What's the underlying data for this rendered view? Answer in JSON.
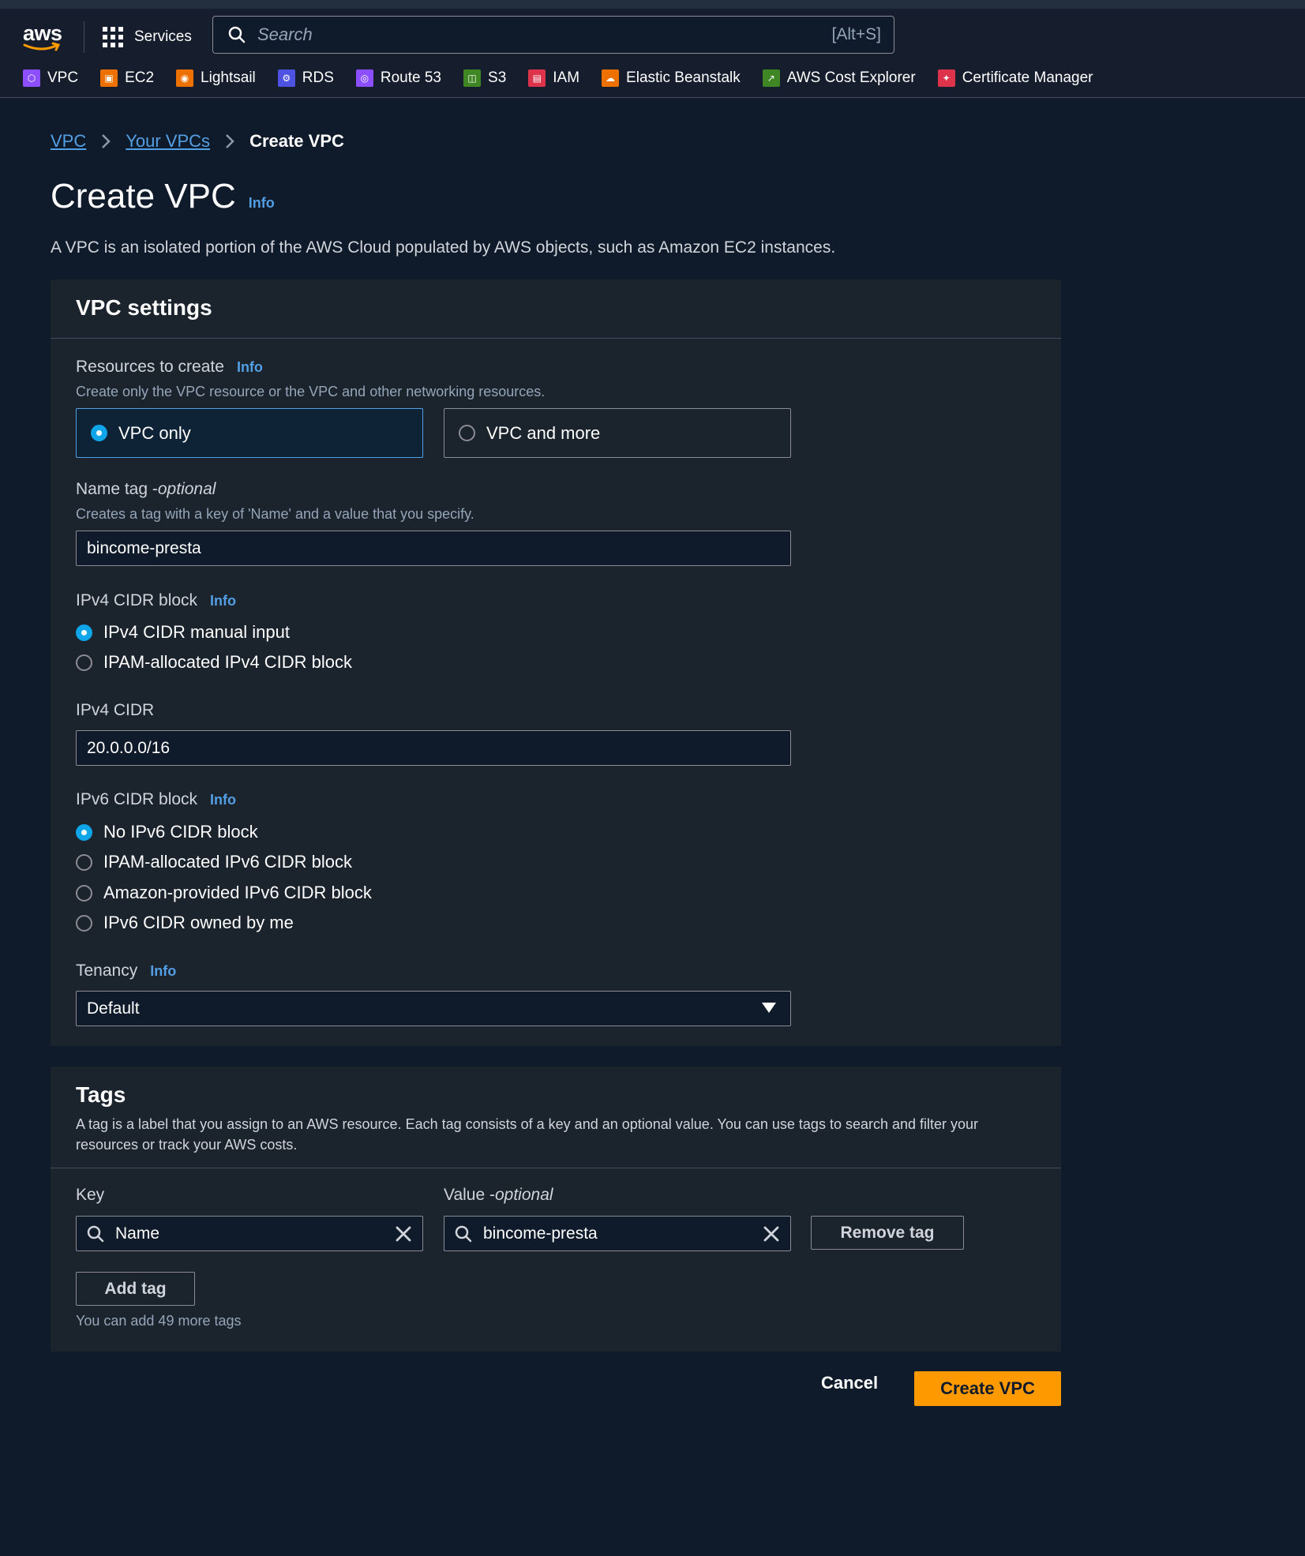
{
  "nav": {
    "logo_text": "aws",
    "services_label": "Services",
    "search_placeholder": "Search",
    "search_shortcut": "[Alt+S]",
    "favorites": [
      {
        "label": "VPC",
        "icon": "vpc-icon",
        "color": "#8c4fff"
      },
      {
        "label": "EC2",
        "icon": "ec2-icon",
        "color": "#ed7100"
      },
      {
        "label": "Lightsail",
        "icon": "lightsail-icon",
        "color": "#ed7100"
      },
      {
        "label": "RDS",
        "icon": "rds-icon",
        "color": "#4d52e0"
      },
      {
        "label": "Route 53",
        "icon": "route53-icon",
        "color": "#8c4fff"
      },
      {
        "label": "S3",
        "icon": "s3-icon",
        "color": "#3f8624"
      },
      {
        "label": "IAM",
        "icon": "iam-icon",
        "color": "#dd344c"
      },
      {
        "label": "Elastic Beanstalk",
        "icon": "elastic-beanstalk-icon",
        "color": "#ed7100"
      },
      {
        "label": "AWS Cost Explorer",
        "icon": "cost-explorer-icon",
        "color": "#3f8624"
      },
      {
        "label": "Certificate Manager",
        "icon": "certificate-manager-icon",
        "color": "#dd344c"
      }
    ]
  },
  "breadcrumb": {
    "items": [
      "VPC",
      "Your VPCs"
    ],
    "current": "Create VPC"
  },
  "page": {
    "title": "Create VPC",
    "info": "Info",
    "description": "A VPC is an isolated portion of the AWS Cloud populated by AWS objects, such as Amazon EC2 instances."
  },
  "vpc_settings": {
    "title": "VPC settings",
    "resources": {
      "label": "Resources to create",
      "info": "Info",
      "description": "Create only the VPC resource or the VPC and other networking resources.",
      "options": [
        "VPC only",
        "VPC and more"
      ],
      "selected": "VPC only"
    },
    "name_tag": {
      "label": "Name tag - ",
      "label_optional": "optional",
      "description": "Creates a tag with a key of 'Name' and a value that you specify.",
      "value": "bincome-presta"
    },
    "ipv4_block": {
      "label": "IPv4 CIDR block",
      "info": "Info",
      "options": [
        "IPv4 CIDR manual input",
        "IPAM-allocated IPv4 CIDR block"
      ],
      "selected": "IPv4 CIDR manual input"
    },
    "ipv4_cidr": {
      "label": "IPv4 CIDR",
      "value": "20.0.0.0/16"
    },
    "ipv6_block": {
      "label": "IPv6 CIDR block",
      "info": "Info",
      "options": [
        "No IPv6 CIDR block",
        "IPAM-allocated IPv6 CIDR block",
        "Amazon-provided IPv6 CIDR block",
        "IPv6 CIDR owned by me"
      ],
      "selected": "No IPv6 CIDR block"
    },
    "tenancy": {
      "label": "Tenancy",
      "info": "Info",
      "value": "Default"
    }
  },
  "tags": {
    "title": "Tags",
    "description": "A tag is a label that you assign to an AWS resource. Each tag consists of a key and an optional value. You can use tags to search and filter your resources or track your AWS costs.",
    "key_label": "Key",
    "value_label": "Value - ",
    "value_label_optional": "optional",
    "rows": [
      {
        "key": "Name",
        "value": "bincome-presta"
      }
    ],
    "remove_label": "Remove tag",
    "add_label": "Add tag",
    "hint": "You can add 49 more tags"
  },
  "footer": {
    "cancel_label": "Cancel",
    "submit_label": "Create VPC"
  },
  "colors": {
    "accent": "#539fe5",
    "primary_button": "#ff9900",
    "radio_selected": "#0ea5e9"
  }
}
